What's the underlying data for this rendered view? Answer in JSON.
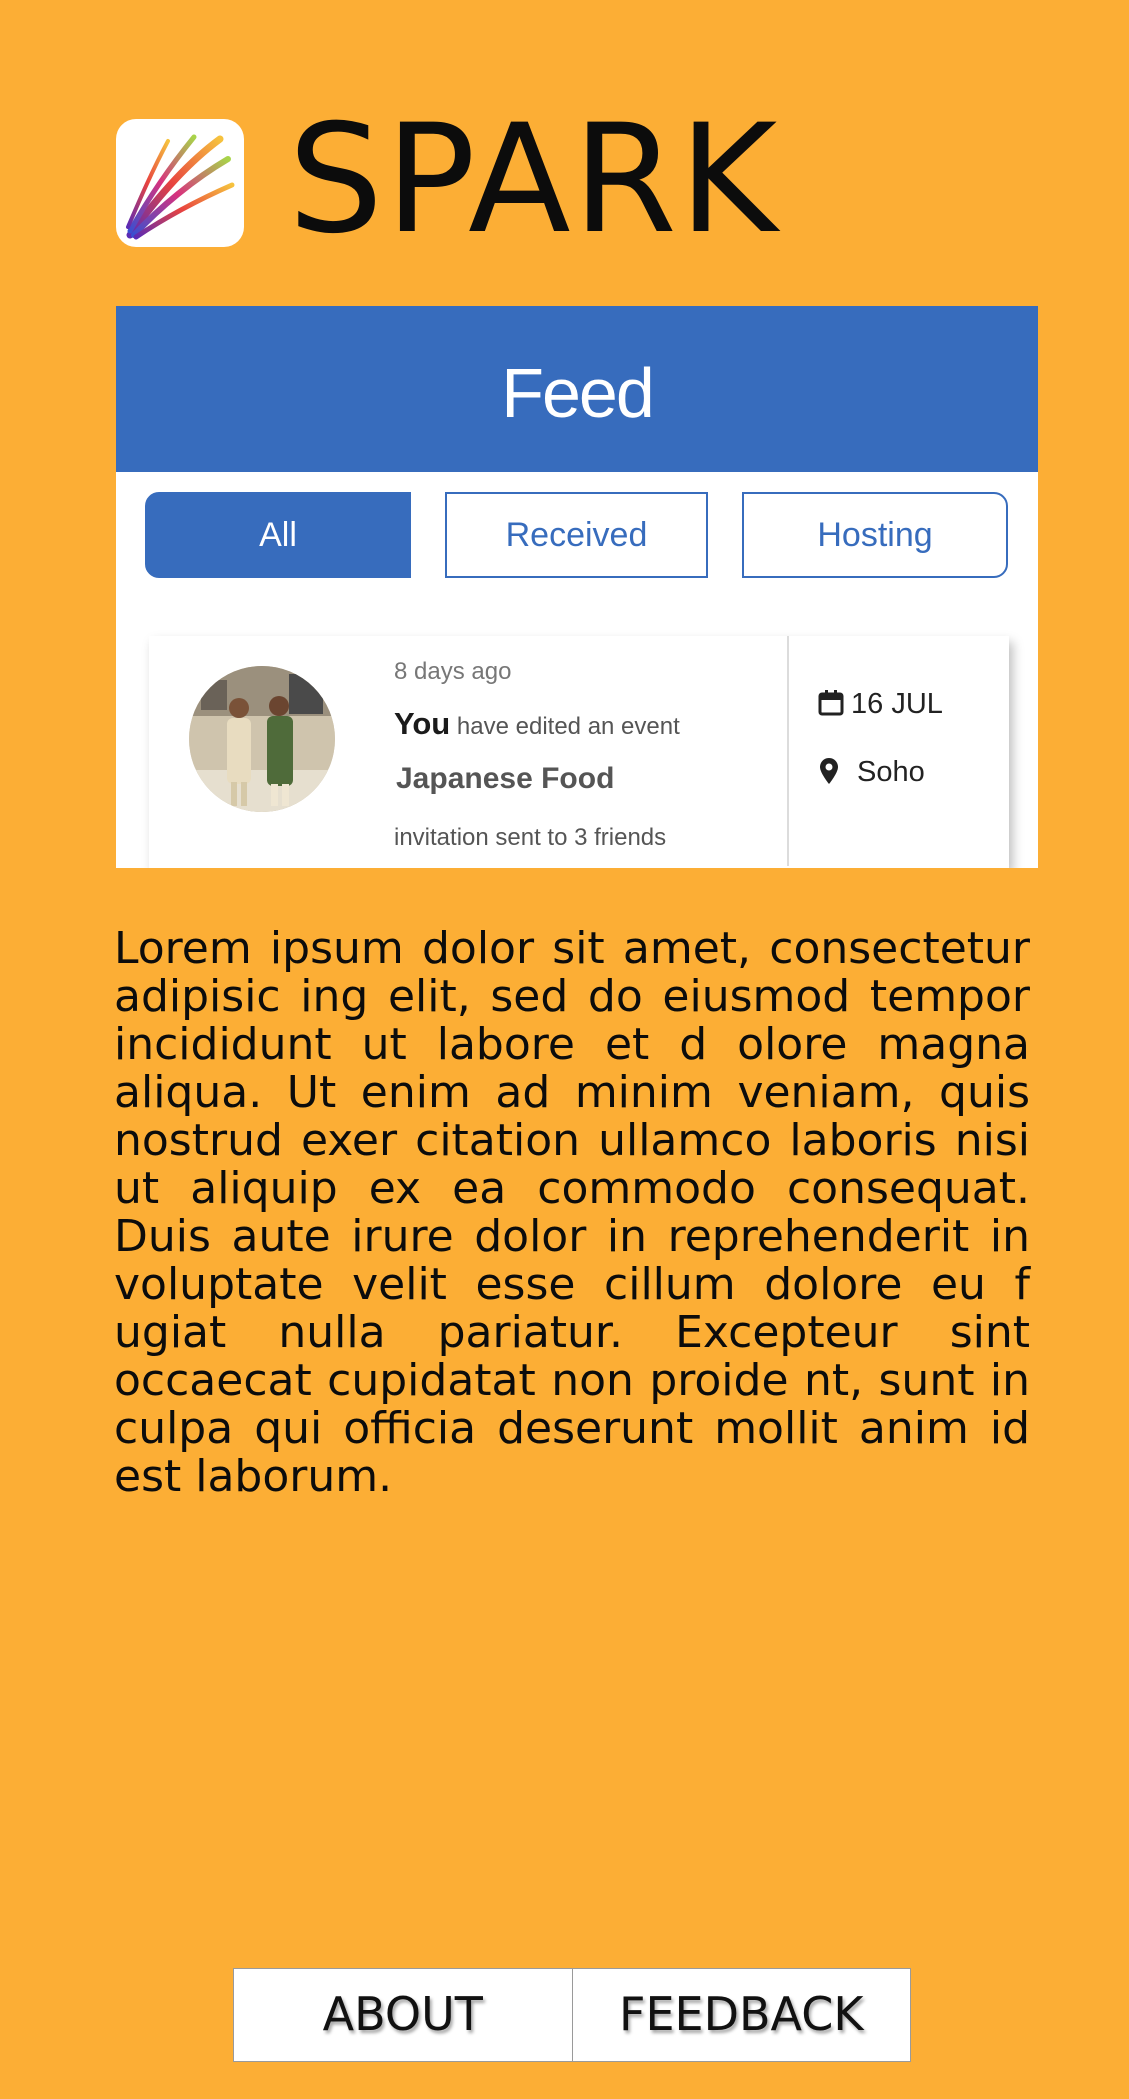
{
  "app": {
    "title": "SPARK",
    "icon": "spark-logo-icon"
  },
  "feed_preview": {
    "header": "Feed",
    "tabs": [
      {
        "label": "All",
        "active": true
      },
      {
        "label": "Received",
        "active": false
      },
      {
        "label": "Hosting",
        "active": false
      }
    ],
    "card": {
      "time_ago": "8 days ago",
      "actor": "You",
      "action": "have edited an event",
      "event_name": "Japanese Food",
      "note": "invitation sent to 3 friends",
      "date": "16 JUL",
      "date_icon": "calendar-icon",
      "location": "Soho",
      "location_icon": "map-pin-icon"
    }
  },
  "description": "Lorem ipsum dolor sit amet, consectetur adipisic ing elit, sed do eiusmod tempor incididunt ut labore et d olore magna aliqua. Ut enim ad minim veniam, quis nostrud exer citation ullamco laboris nisi ut aliquip ex ea commodo consequat. Duis  aute irure dolor in reprehenderit in voluptate velit esse cillum dolore eu f ugiat nulla pariatur. Excepteur sint occaecat cupidatat non proide nt, sunt in culpa qui officia deserunt mollit anim id est laborum.",
  "footer": {
    "about_label": "ABOUT",
    "feedback_label": "FEEDBACK"
  },
  "colors": {
    "background": "#fcae35",
    "feed_blue": "#376cbd"
  }
}
